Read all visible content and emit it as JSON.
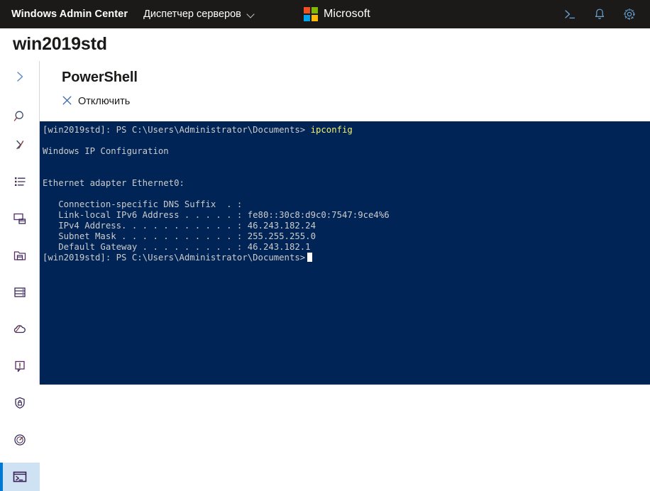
{
  "topbar": {
    "brand": "Windows Admin Center",
    "section_label": "Диспетчер серверов",
    "section_chevron": "chevron-down-icon",
    "logo_text": "Microsoft",
    "logo_colors": [
      "#f25022",
      "#7fba00",
      "#00a4ef",
      "#ffb900"
    ],
    "background": "#1b1a19",
    "icon_color": "#6ba5d7",
    "actions": [
      {
        "name": "powershell-console-icon",
        "title": "PowerShell"
      },
      {
        "name": "notifications-bell-icon",
        "title": "Уведомления"
      },
      {
        "name": "settings-gear-icon",
        "title": "Параметры"
      }
    ]
  },
  "page": {
    "title": "win2019std"
  },
  "rail": {
    "accent": "#0078d4",
    "selected_background": "#cfe2f3",
    "items": [
      {
        "name": "expand-chevron-icon",
        "label": "Развернуть",
        "selected": false
      },
      {
        "name": "search-icon",
        "label": "Поиск",
        "selected": false
      },
      {
        "name": "collapse-tools-icon",
        "label": "Свернуть",
        "selected": false
      },
      {
        "name": "overview-list-icon",
        "label": "Обзор",
        "selected": false
      },
      {
        "name": "remote-desktop-icon",
        "label": "Удаленный рабочий стол",
        "selected": false
      },
      {
        "name": "files-folder-icon",
        "label": "Файлы",
        "selected": false
      },
      {
        "name": "storage-server-icon",
        "label": "Хранилище",
        "selected": false
      },
      {
        "name": "azure-cloud-icon",
        "label": "Azure",
        "selected": false
      },
      {
        "name": "alerts-icon",
        "label": "События",
        "selected": false
      },
      {
        "name": "security-shield-lock-icon",
        "label": "Безопасность",
        "selected": false
      },
      {
        "name": "performance-gauge-icon",
        "label": "Производительность",
        "selected": false
      },
      {
        "name": "powershell-terminal-icon",
        "label": "PowerShell",
        "selected": true
      }
    ]
  },
  "tool": {
    "title": "PowerShell",
    "disconnect_button": {
      "label": "Отключить",
      "icon": "close-x-icon"
    }
  },
  "terminal": {
    "background": "#012456",
    "foreground": "#cccccc",
    "command_color": "#f3f36b",
    "prompt": "[win2019std]: PS C:\\Users\\Administrator\\Documents>",
    "command": "ipconfig",
    "lines": [
      {
        "text": "",
        "type": "blank"
      },
      {
        "text": "Windows IP Configuration",
        "type": "out"
      },
      {
        "text": "",
        "type": "blank"
      },
      {
        "text": "",
        "type": "blank"
      },
      {
        "text": "Ethernet adapter Ethernet0:",
        "type": "out"
      },
      {
        "text": "",
        "type": "blank"
      },
      {
        "text": "   Connection-specific DNS Suffix  . :",
        "type": "out"
      },
      {
        "text": "   Link-local IPv6 Address . . . . . : fe80::30c8:d9c0:7547:9ce4%6",
        "type": "out"
      },
      {
        "text": "   IPv4 Address. . . . . . . . . . . : 46.243.182.24",
        "type": "out"
      },
      {
        "text": "   Subnet Mask . . . . . . . . . . . : 255.255.255.0",
        "type": "out"
      },
      {
        "text": "   Default Gateway . . . . . . . . . : 46.243.182.1",
        "type": "out"
      }
    ]
  }
}
